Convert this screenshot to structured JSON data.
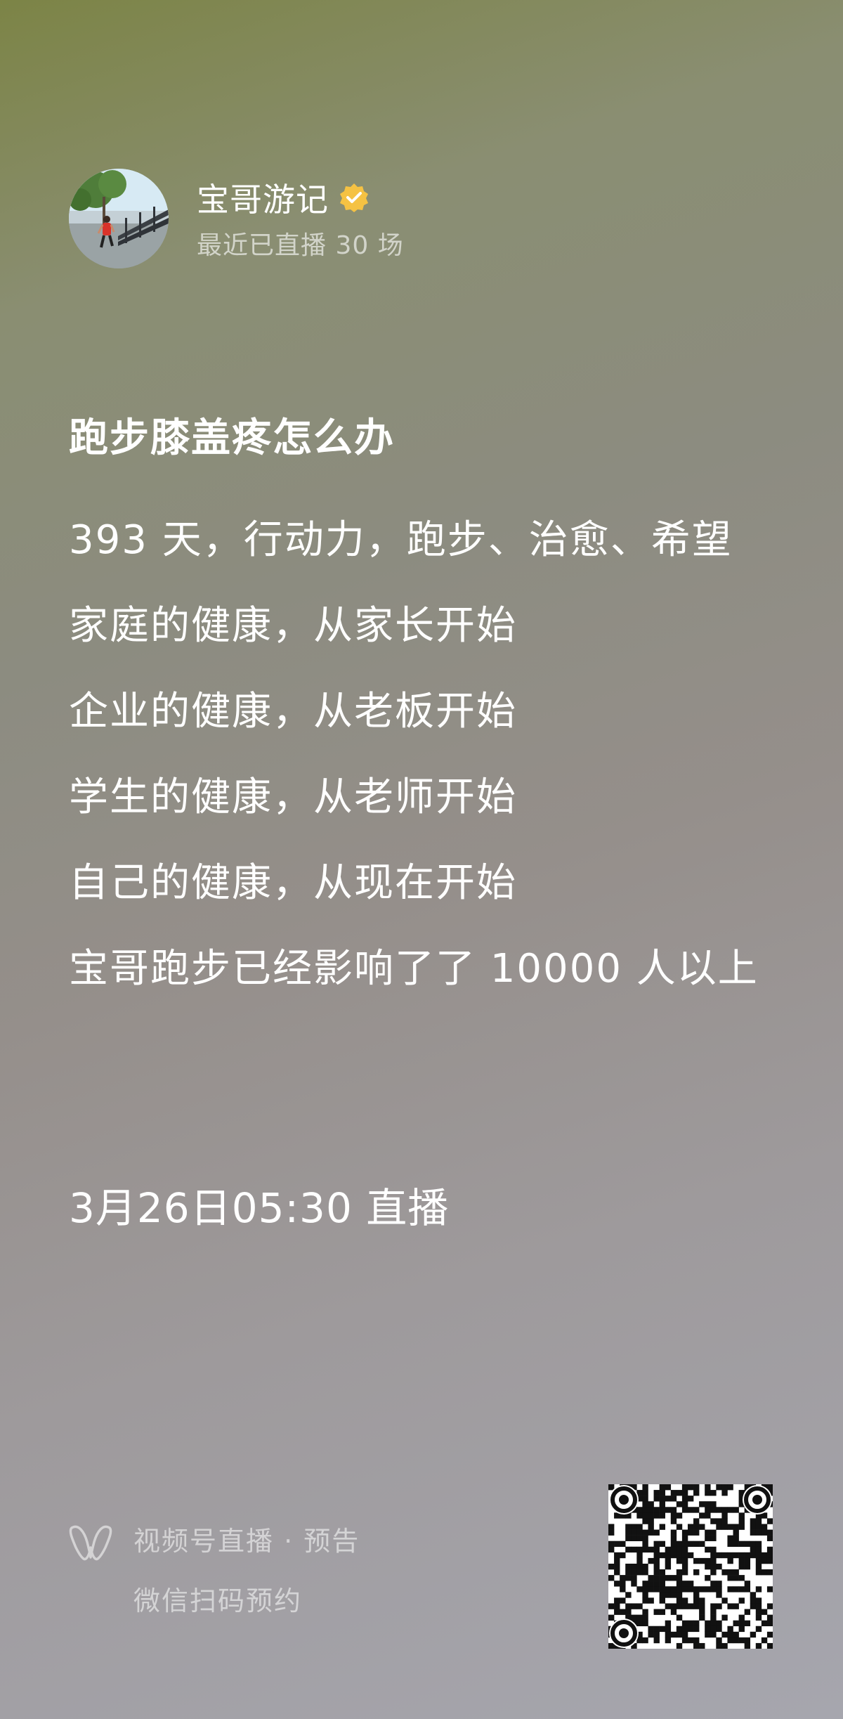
{
  "author": {
    "name": "宝哥游记",
    "subtitle": "最近已直播 30 场",
    "verified_color": "#f5c243"
  },
  "title": "跑步膝盖疼怎么办",
  "lines": [
    "393 天，行动力，跑步、治愈、希望",
    "家庭的健康，从家长开始",
    "企业的健康，从老板开始",
    "学生的健康，从老师开始",
    "自己的健康，从现在开始",
    "宝哥跑步已经影响了了 10000 人以上"
  ],
  "schedule": "3月26日05:30 直播",
  "footer": {
    "line1": "视频号直播 · 预告",
    "line2": "微信扫码预约",
    "icon": "channels-icon"
  },
  "qr": {
    "icon": "qr-code-icon"
  }
}
